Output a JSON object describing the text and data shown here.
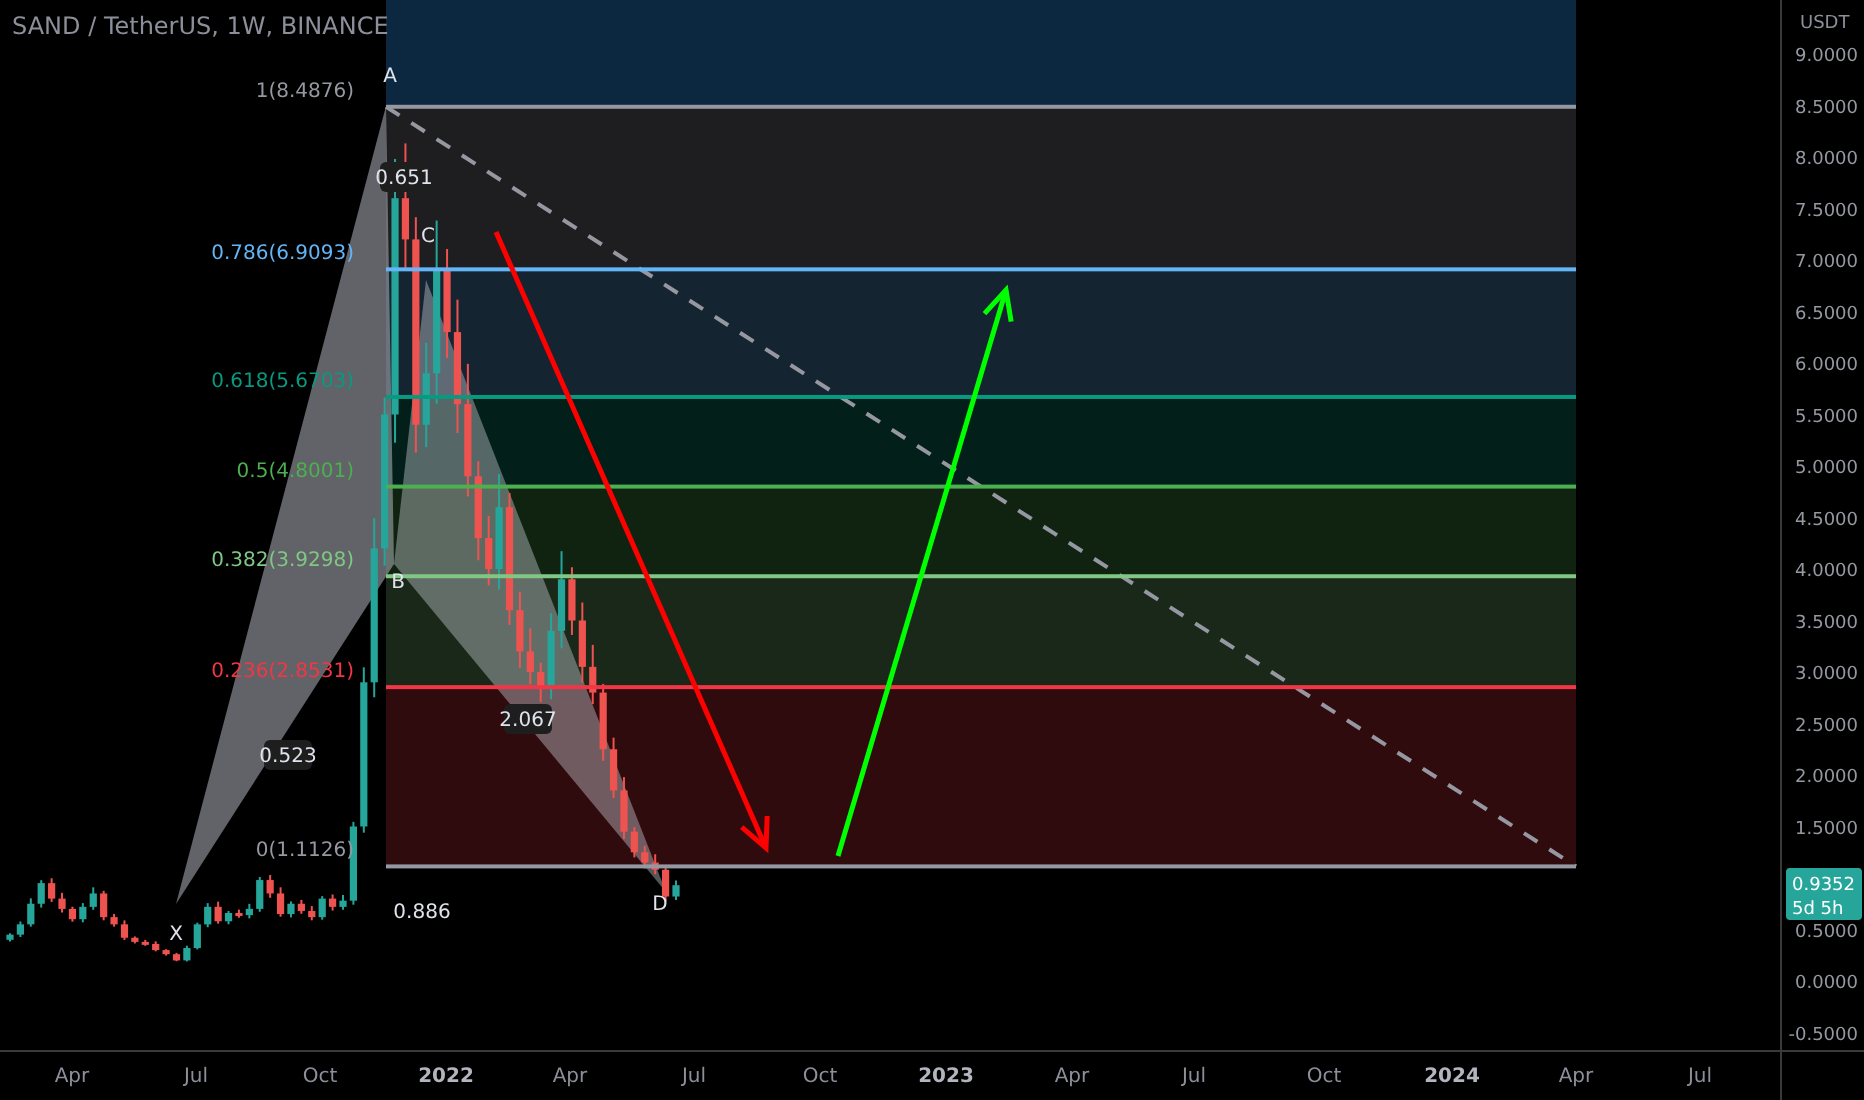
{
  "header": {
    "title": "SAND / TetherUS, 1W, BINANCE"
  },
  "fib_levels": [
    {
      "label": "1(8.4876)",
      "color": "#9598a1"
    },
    {
      "label": "0.786(6.9093)",
      "color": "#64b5f6"
    },
    {
      "label": "0.618(5.6703)",
      "color": "#089981"
    },
    {
      "label": "0.5(4.8001)",
      "color": "#4caf50"
    },
    {
      "label": "0.382(3.9298)",
      "color": "#81c784"
    },
    {
      "label": "0.236(2.8531)",
      "color": "#f23645"
    },
    {
      "label": "0(1.1126)",
      "color": "#9598a1"
    }
  ],
  "pattern_points": [
    "X",
    "A",
    "B",
    "C",
    "D"
  ],
  "ratios": [
    "0.651",
    "0.523",
    "2.067",
    "0.886"
  ],
  "price_axis": {
    "unit": "USDT",
    "ticks": [
      "9.0000",
      "8.5000",
      "8.0000",
      "7.5000",
      "7.0000",
      "6.5000",
      "6.0000",
      "5.5000",
      "5.0000",
      "4.5000",
      "4.0000",
      "3.5000",
      "3.0000",
      "2.5000",
      "2.0000",
      "1.5000",
      "0.5000",
      "0.0000",
      "-0.5000"
    ]
  },
  "price_badge": {
    "price": "0.9352",
    "countdown": "5d 5h"
  },
  "time_axis": [
    {
      "label": "Apr",
      "kind": "month"
    },
    {
      "label": "Jul",
      "kind": "month"
    },
    {
      "label": "Oct",
      "kind": "month"
    },
    {
      "label": "2022",
      "kind": "year"
    },
    {
      "label": "Apr",
      "kind": "month"
    },
    {
      "label": "Jul",
      "kind": "month"
    },
    {
      "label": "Oct",
      "kind": "month"
    },
    {
      "label": "2023",
      "kind": "year"
    },
    {
      "label": "Apr",
      "kind": "month"
    },
    {
      "label": "Jul",
      "kind": "month"
    },
    {
      "label": "Oct",
      "kind": "month"
    },
    {
      "label": "2024",
      "kind": "year"
    },
    {
      "label": "Apr",
      "kind": "month"
    },
    {
      "label": "Jul",
      "kind": "month"
    }
  ]
}
